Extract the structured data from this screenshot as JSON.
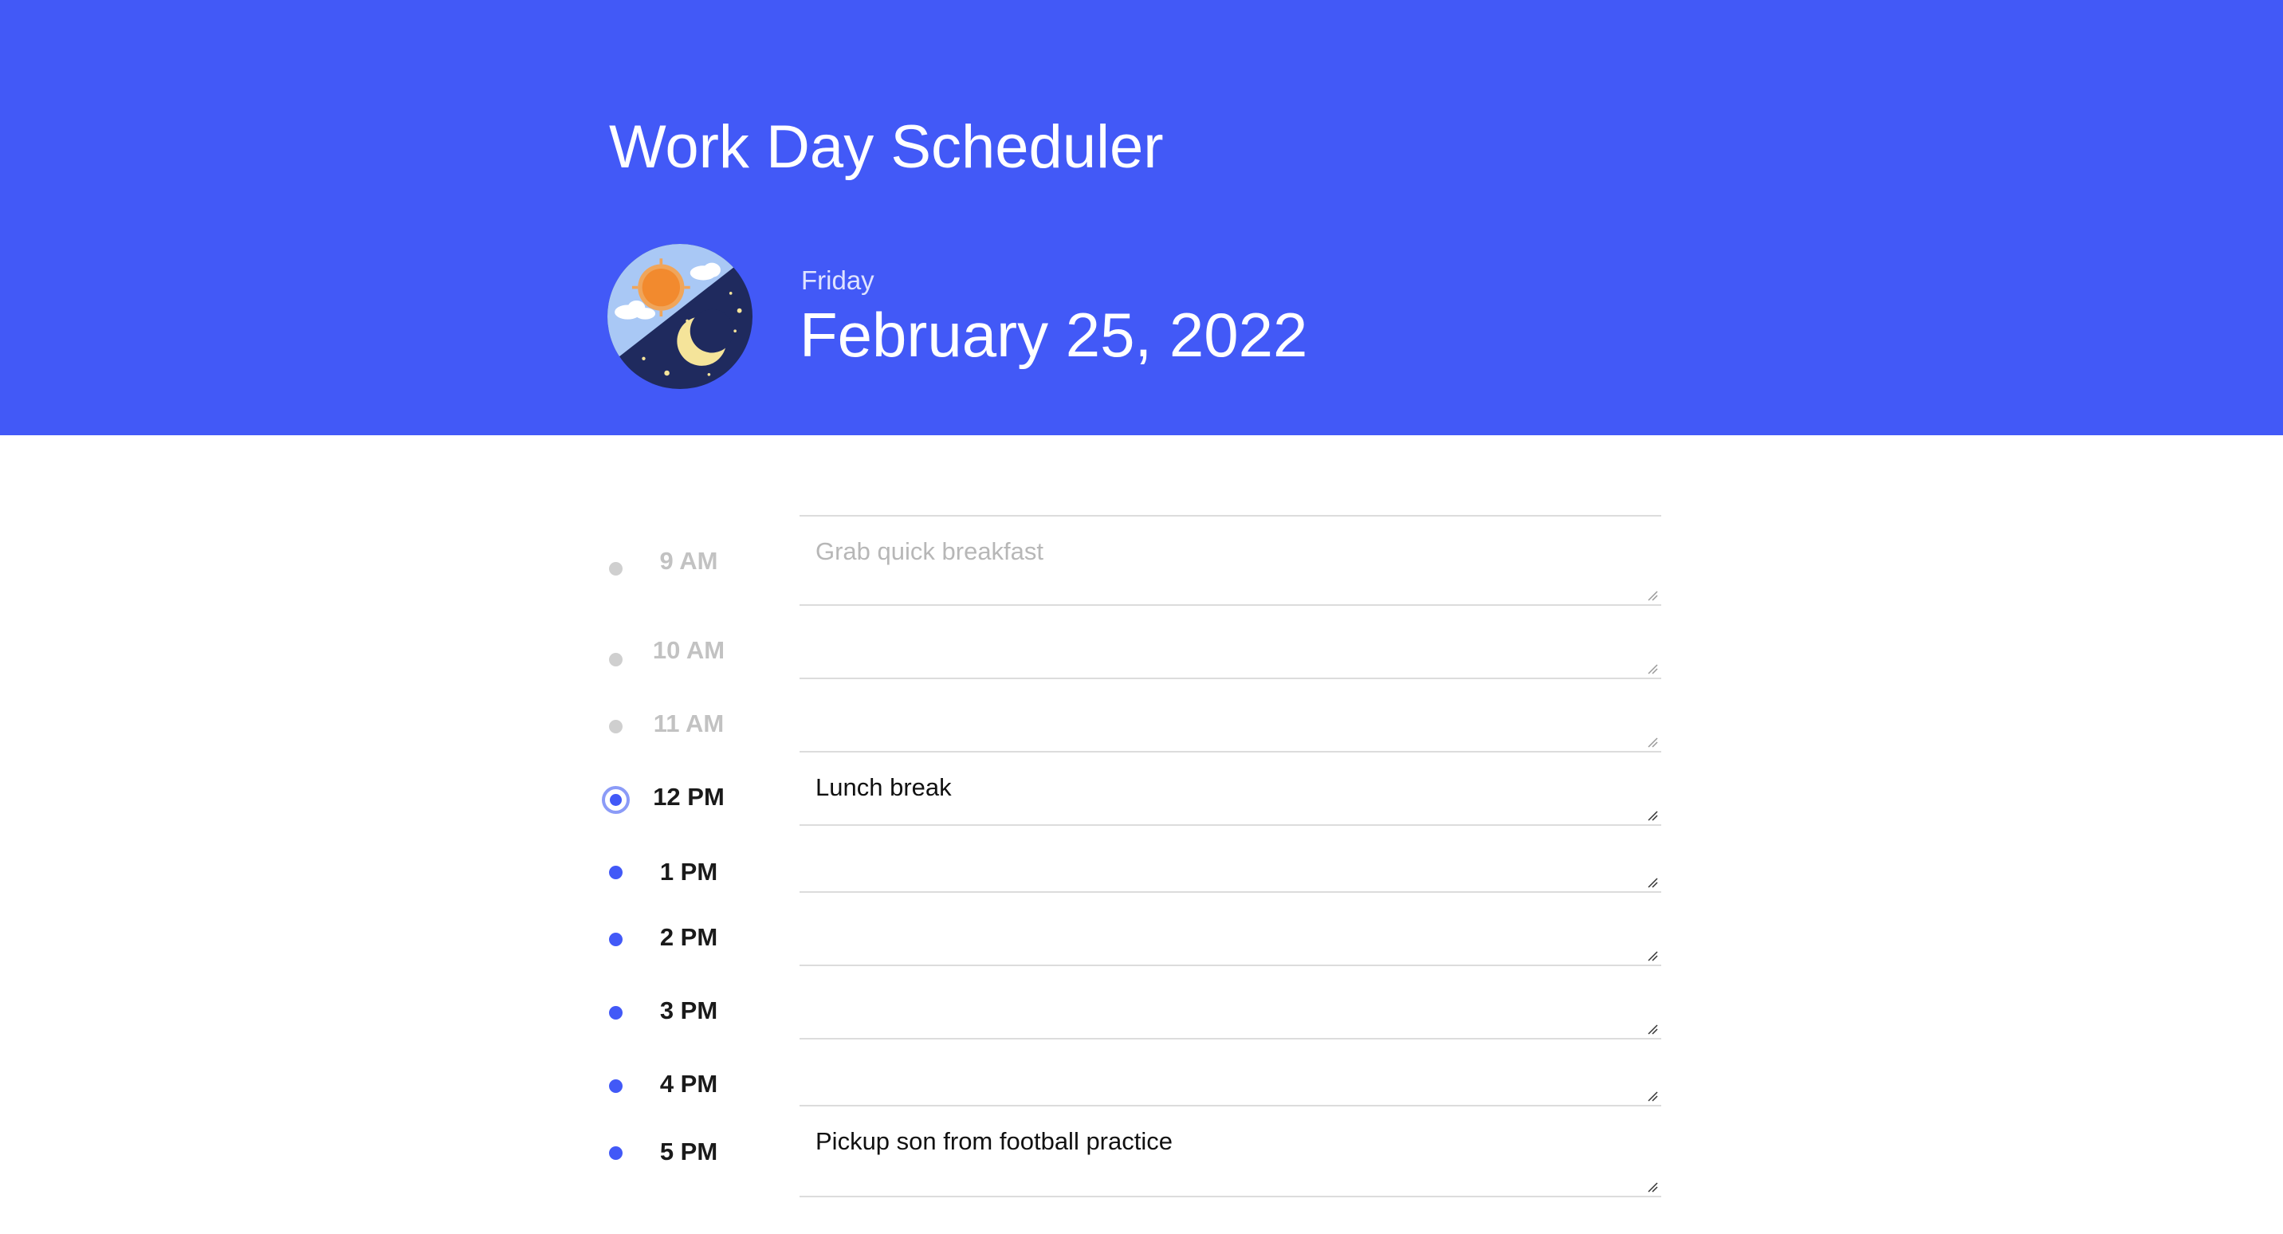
{
  "header": {
    "title": "Work Day Scheduler",
    "weekday": "Friday",
    "date": "February 25, 2022"
  },
  "colors": {
    "header_bg": "#4259f7",
    "past": "#cfcfcf",
    "future": "#4259f7"
  },
  "icons": {
    "day_night": "sun-and-moon-icon"
  },
  "schedule": {
    "slots": [
      {
        "hour": "9 AM",
        "state": "past",
        "text": "Grab quick breakfast"
      },
      {
        "hour": "10 AM",
        "state": "past",
        "text": ""
      },
      {
        "hour": "11 AM",
        "state": "past",
        "text": ""
      },
      {
        "hour": "12 PM",
        "state": "present",
        "text": "Lunch break"
      },
      {
        "hour": "1 PM",
        "state": "future",
        "text": ""
      },
      {
        "hour": "2 PM",
        "state": "future",
        "text": ""
      },
      {
        "hour": "3 PM",
        "state": "future",
        "text": ""
      },
      {
        "hour": "4 PM",
        "state": "future",
        "text": ""
      },
      {
        "hour": "5 PM",
        "state": "future",
        "text": "Pickup son from football practice"
      }
    ]
  }
}
